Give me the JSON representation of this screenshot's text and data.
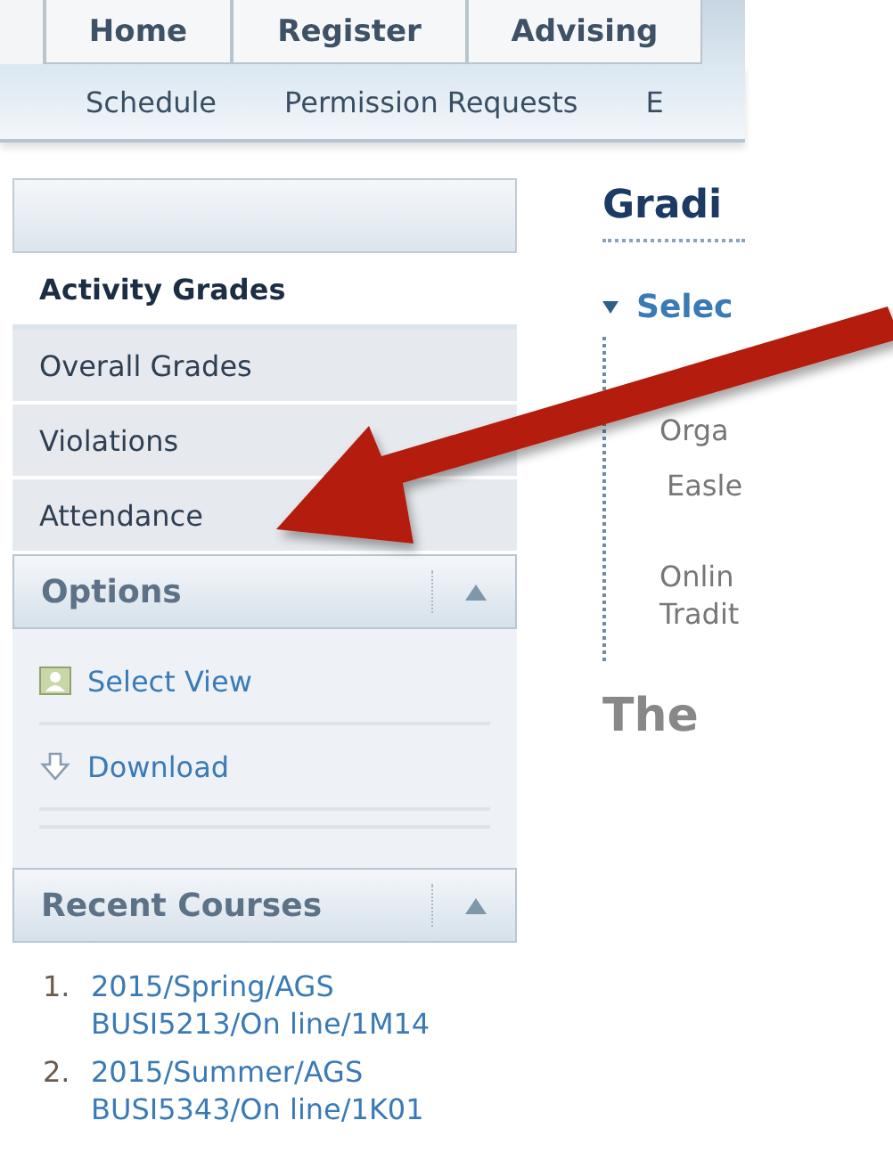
{
  "tabs": [
    {
      "label": "Home",
      "selected": false
    },
    {
      "label": "Register",
      "selected": false
    },
    {
      "label": "Advising",
      "selected": false
    }
  ],
  "subnav": [
    {
      "label": "Schedule"
    },
    {
      "label": "Permission Requests"
    },
    {
      "label": "E"
    }
  ],
  "sidebar": {
    "items": [
      {
        "label": "Activity Grades",
        "selected": true
      },
      {
        "label": "Overall Grades",
        "selected": false
      },
      {
        "label": "Violations",
        "selected": false
      },
      {
        "label": "Attendance",
        "selected": false
      }
    ]
  },
  "options": {
    "title": "Options",
    "expanded": true,
    "items": [
      {
        "label": "Select View",
        "kind": "view"
      },
      {
        "label": "Download",
        "kind": "download"
      }
    ]
  },
  "recent_courses": {
    "title": "Recent Courses",
    "expanded": true,
    "items": [
      {
        "number": "1.",
        "label": "2015/Spring/AGS BUSI5213/On line/1M14"
      },
      {
        "number": "2.",
        "label": "2015/Summer/AGS BUSI5343/On line/1K01"
      }
    ]
  },
  "main": {
    "title": "Gradi",
    "section": {
      "label": "Selec",
      "expanded": true
    },
    "lines": [
      {
        "text": "Orga",
        "kind": "text"
      },
      {
        "text": "Easle",
        "kind": "indent"
      },
      {
        "text": "Onlin",
        "kind": "gap"
      },
      {
        "text": "Tradit",
        "kind": "text"
      }
    ],
    "subtitle": "The"
  }
}
